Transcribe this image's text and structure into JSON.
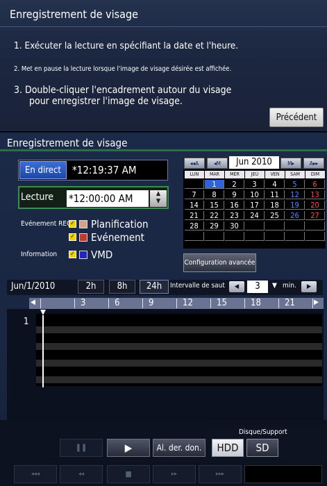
{
  "header": {
    "title": "Enregistrement de visage",
    "steps": [
      "1. Exécuter la lecture en spécifiant la date et l'heure.",
      "2. Met en pause la lecture lorsque l'image de visage désirée est affichée.",
      "3. Double-cliquer l'encadrement autour du visage",
      "pour enregistrer l'image de visage."
    ],
    "prev_button": "Précédent"
  },
  "panel": {
    "title": "Enregistrement de visage",
    "live_button": "En direct",
    "live_time": "*12:19:37 AM",
    "playback_label": "Lecture",
    "playback_time": "*12:00:00 AM",
    "rec_event_label": "Evénement REC",
    "rec_types": [
      {
        "label": "Planification",
        "color": "#d9a08a"
      },
      {
        "label": "Evénement",
        "color": "#c0392b"
      }
    ],
    "info_label": "Information",
    "info_type": {
      "label": "VMD",
      "color": "#2222cc"
    },
    "advanced_button": "Configuration avancée"
  },
  "calendar": {
    "nav": [
      "◂◂A",
      "◂M",
      "M▸",
      "A▸▸"
    ],
    "month": "Jun 2010",
    "day_headers": [
      "LUN",
      "MAR",
      "MER",
      "JEU",
      "VEN",
      "SAM",
      "DIM"
    ],
    "weeks": [
      [
        "",
        "1",
        "2",
        "3",
        "4",
        "5",
        "6"
      ],
      [
        "7",
        "8",
        "9",
        "10",
        "11",
        "12",
        "13"
      ],
      [
        "14",
        "15",
        "16",
        "17",
        "18",
        "19",
        "20"
      ],
      [
        "21",
        "22",
        "23",
        "24",
        "25",
        "26",
        "27"
      ],
      [
        "28",
        "29",
        "30",
        "",
        "",
        "",
        ""
      ],
      [
        "",
        "",
        "",
        "",
        "",
        "",
        ""
      ]
    ],
    "selected_day": "1",
    "saturday_color": "#4f8cff",
    "sunday_color": "#ff4a4a"
  },
  "timeline": {
    "date": "Jun/1/2010",
    "ranges": [
      "2h",
      "8h",
      "24h"
    ],
    "selected_range": "24h",
    "jump_label": "Intervalle de saut",
    "jump_value": "3",
    "jump_unit": "min.",
    "hours": [
      "3",
      "6",
      "9",
      "12",
      "15",
      "18",
      "21"
    ],
    "channel": "1"
  },
  "controls": {
    "pause": "❚❚",
    "play": "▶",
    "last_data": "Al. der. don.",
    "disk_label": "Disque/Support",
    "hdd": "HDD",
    "sd": "SD",
    "skip_back": "◂◂◂",
    "rewind": "◂◂",
    "stop": "■",
    "fast_forward": "▸▸",
    "skip_forward": "▸▸▸"
  }
}
